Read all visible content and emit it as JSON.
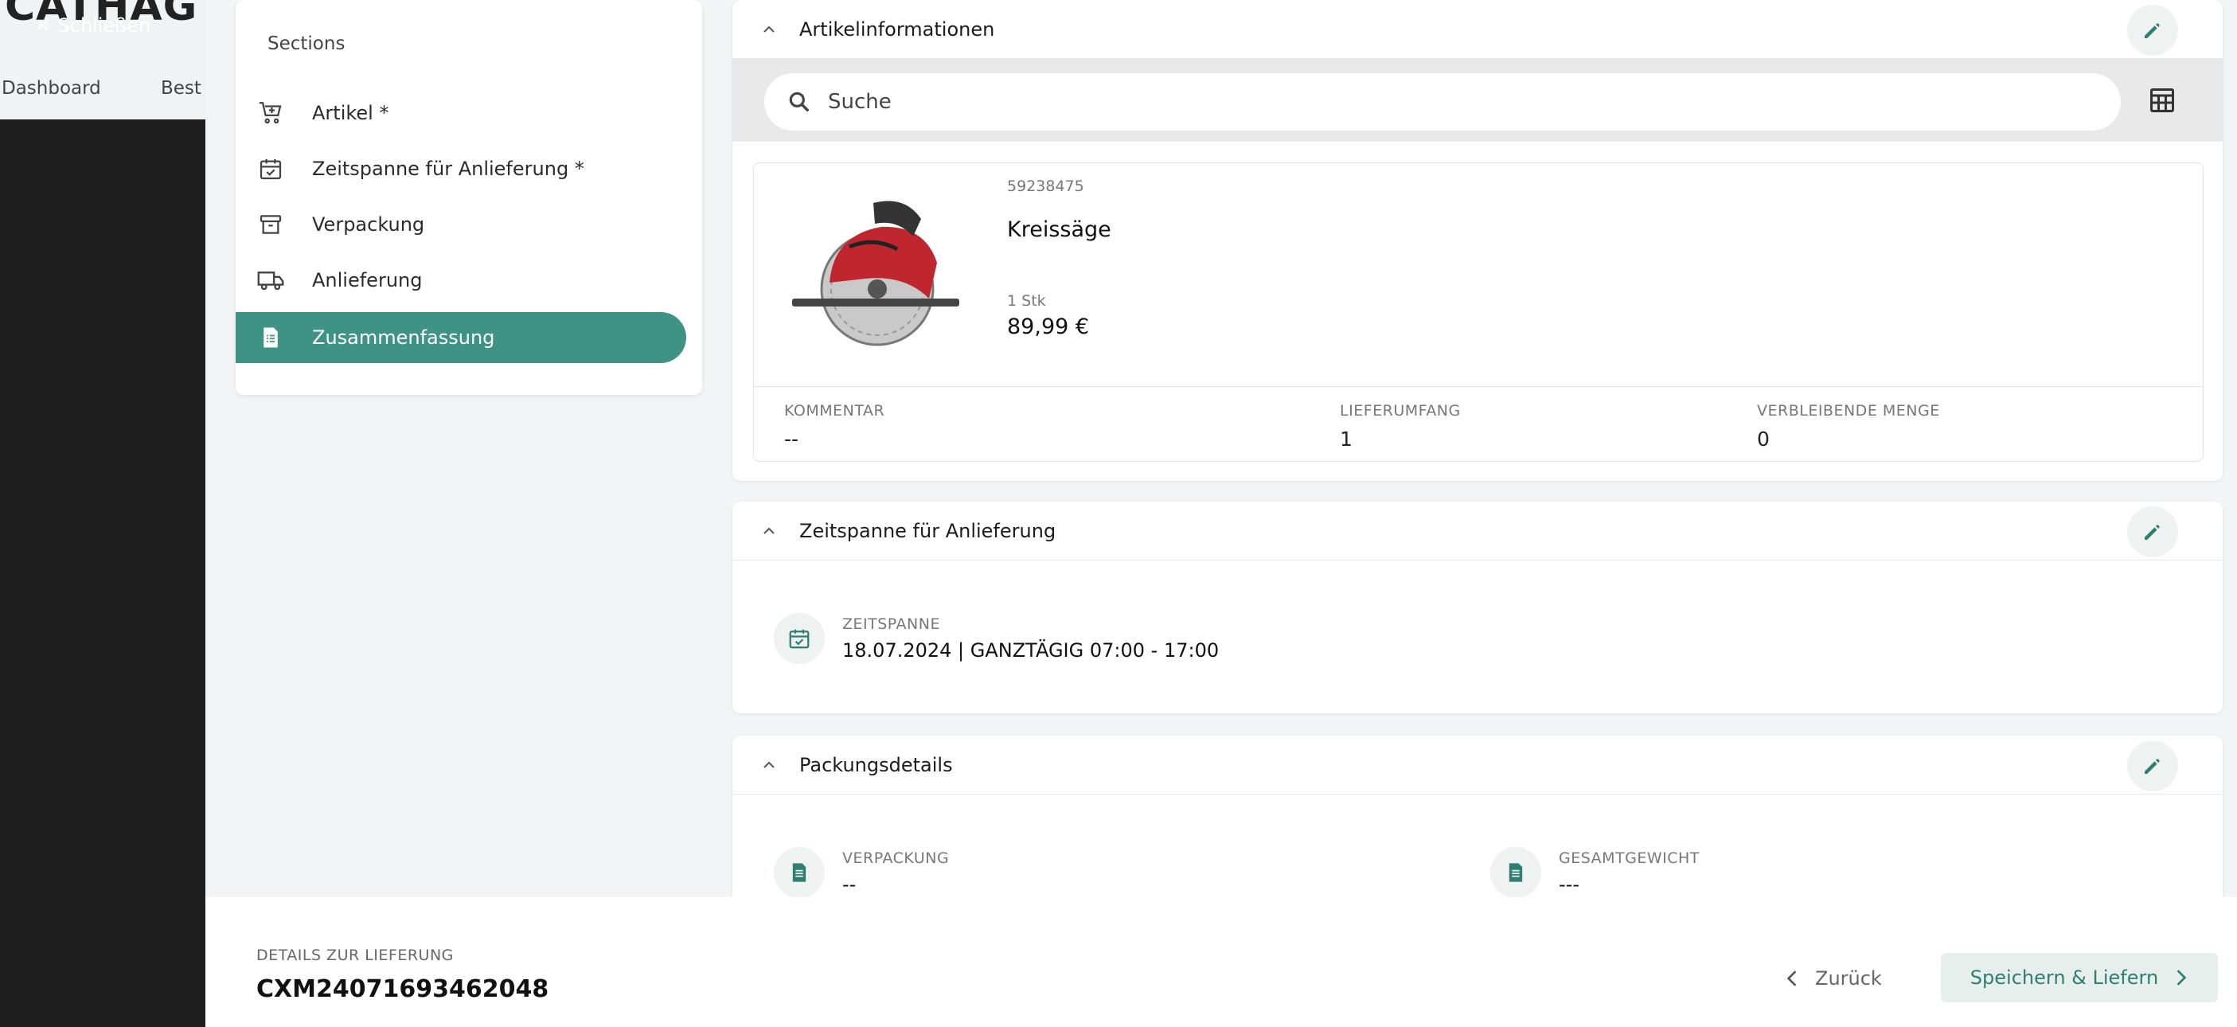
{
  "backdrop": {
    "logo_text": "CATHAG",
    "nav_items": [
      "Dashboard",
      "Best"
    ],
    "close_label": "Schließen"
  },
  "sections": {
    "title": "Sections",
    "items": [
      {
        "label": "Artikel *",
        "icon": "cart-icon",
        "active": false
      },
      {
        "label": "Zeitspanne für Anlieferung *",
        "icon": "calendar-check-icon",
        "active": false
      },
      {
        "label": "Verpackung",
        "icon": "archive-box-icon",
        "active": false
      },
      {
        "label": "Anlieferung",
        "icon": "truck-icon",
        "active": false
      },
      {
        "label": "Zusammenfassung",
        "icon": "summary-document-icon",
        "active": true
      }
    ]
  },
  "articles_card": {
    "title": "Artikelinformationen",
    "search_placeholder": "Suche",
    "article": {
      "number": "59238475",
      "name": "Kreissäge",
      "quantity": "1 Stk",
      "price": "89,99 €",
      "comment_label": "KOMMENTAR",
      "comment_value": "--",
      "delivery_scope_label": "LIEFERUMFANG",
      "delivery_scope_value": "1",
      "remaining_label": "VERBLEIBENDE MENGE",
      "remaining_value": "0"
    }
  },
  "timeframe_card": {
    "title": "Zeitspanne für Anlieferung",
    "label": "ZEITSPANNE",
    "value": "18.07.2024 | GANZTÄGIG 07:00 - 17:00"
  },
  "packaging_card": {
    "title": "Packungsdetails",
    "packaging_label": "VERPACKUNG",
    "packaging_value": "--",
    "weight_label": "GESAMTGEWICHT",
    "weight_value": "---"
  },
  "footer": {
    "label": "DETAILS ZUR LIEFERUNG",
    "delivery_id": "CXM24071693462048",
    "back_label": "Zurück",
    "save_label": "Speichern & Liefern"
  },
  "colors": {
    "accent": "#3f9385",
    "accent_text": "#2e7e71",
    "backdrop": "#1f1f1f"
  }
}
